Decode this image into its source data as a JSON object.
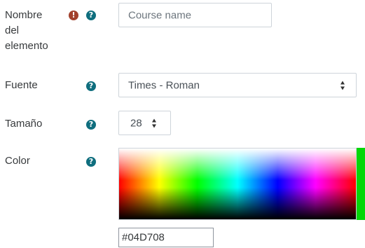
{
  "fields": {
    "element_name": {
      "label_lines": [
        "Nombre",
        "del",
        "elemento"
      ],
      "placeholder": "Course name",
      "required_icon": "exclamation-circle-icon",
      "help_icon": "question-circle-icon"
    },
    "font": {
      "label": "Fuente",
      "value": "Times - Roman",
      "help_icon": "question-circle-icon"
    },
    "size": {
      "label": "Tamaño",
      "value": "28",
      "help_icon": "question-circle-icon"
    },
    "color": {
      "label": "Color",
      "value": "#04D708",
      "help_icon": "question-circle-icon"
    }
  },
  "colors": {
    "required_icon": "#a2412d",
    "help_icon": "#0f6e7e",
    "selected_swatch": "#04D708"
  }
}
